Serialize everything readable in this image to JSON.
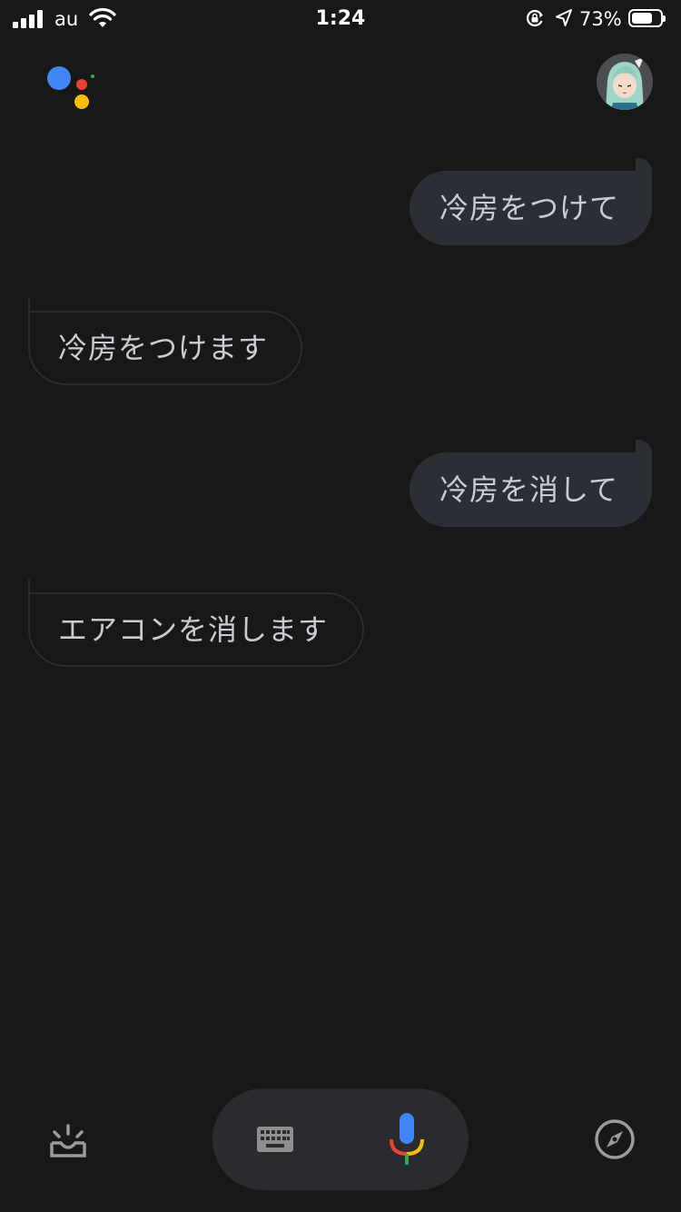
{
  "status_bar": {
    "carrier": "au",
    "time": "1:24",
    "battery_percent": "73%",
    "battery_level": 0.73
  },
  "messages": [
    {
      "sender": "user",
      "text": "冷房をつけて"
    },
    {
      "sender": "assistant",
      "text": "冷房をつけます"
    },
    {
      "sender": "user",
      "text": "冷房を消して"
    },
    {
      "sender": "assistant",
      "text": "エアコンを消します"
    }
  ],
  "icons": {
    "logo": "google-assistant-logo",
    "avatar": "user-avatar",
    "updates": "inbox-updates-icon",
    "keyboard": "keyboard-icon",
    "mic": "microphone-icon",
    "explore": "compass-icon"
  },
  "colors": {
    "background": "#181819",
    "user_bubble": "#2b2e35",
    "assistant_border": "#2a2c33",
    "text": "#c9cdd3",
    "google_blue": "#4285f4",
    "google_red": "#ea4335",
    "google_yellow": "#fbbc05",
    "google_green": "#34a853"
  }
}
